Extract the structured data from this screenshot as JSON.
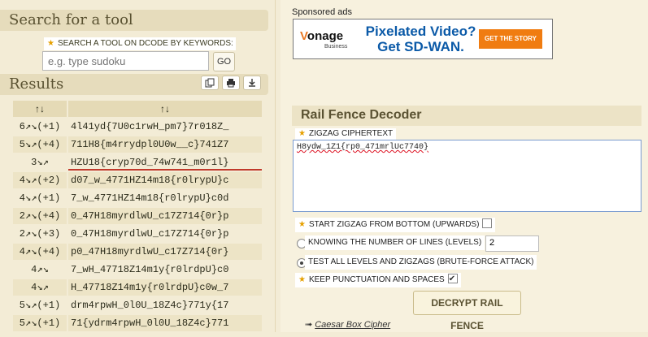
{
  "left": {
    "search_title": "Search for a tool",
    "search_label": "SEARCH A TOOL ON DCODE BY KEYWORDS:",
    "search_placeholder": "e.g. type sudoku",
    "go_label": "GO",
    "results_title": "Results",
    "table_header": [
      "↑↓",
      "↑↓"
    ],
    "rows": [
      {
        "param": "6↗↘(+1)",
        "text": "4l41yd{7U0c1rwH_pm7}7r018Z_"
      },
      {
        "param": "5↘↗(+4)",
        "text": "711H8{m4rrydpl0U0w__c}741Z7"
      },
      {
        "param": "3↘↗",
        "text": "HZU18{cryp70d_74w741_m0r1l}"
      },
      {
        "param": "4↘↗(+2)",
        "text": "d07_w_4771HZ14m18{r0lrypU}c"
      },
      {
        "param": "4↘↗(+1)",
        "text": "7_w_4771HZ14m18{r0lrypU}c0d"
      },
      {
        "param": "2↗↘(+4)",
        "text": "0_47H18myrdlwU_c17Z714{0r}p"
      },
      {
        "param": "2↗↘(+3)",
        "text": "0_47H18myrdlwU_c17Z714{0r}p"
      },
      {
        "param": "4↗↘(+4)",
        "text": "p0_47H18myrdlwU_c17Z714{0r}"
      },
      {
        "param": "4↗↘",
        "text": "7_wH_47718Z14m1y{r0lrdpU}c0"
      },
      {
        "param": "4↘↗",
        "text": "H_47718Z14m1y{r0lrdpU}c0w_7"
      },
      {
        "param": "5↘↗(+1)",
        "text": "drm4rpwH_0l0U_18Z4c}771y{17"
      },
      {
        "param": "5↗↘(+1)",
        "text": "71{ydrm4rpwH_0l0U_18Z4c}771"
      }
    ]
  },
  "ads": {
    "sponsored_label": "Sponsored ads",
    "brand": "onage",
    "brand_v": "V",
    "brand_sub": "Business",
    "headline_1": "Pixelated Video?",
    "headline_2": "Get SD-WAN.",
    "cta": "GET THE STORY"
  },
  "tool": {
    "title": "Rail Fence Decoder",
    "ciphertext_label": "ZIGZAG CIPHERTEXT",
    "ciphertext_value": "H8ydw_1Z1{rp0_471mrlUc7740}",
    "start_bottom_label": "START ZIGZAG FROM BOTTOM (UPWARDS)",
    "known_lines_label": "KNOWING THE NUMBER OF LINES (LEVELS)",
    "levels_value": "2",
    "bruteforce_label": "TEST ALL LEVELS AND ZIGZAGS (BRUTE-FORCE ATTACK)",
    "keep_punct_label": "KEEP PUNCTUATION AND SPACES",
    "decrypt_label": "DECRYPT RAIL FENCE",
    "related_link": "Caesar Box Cipher"
  },
  "colors": {
    "accent_star": "#e6a000",
    "ad_cta": "#f07c11",
    "ad_headline": "#0b5aa8",
    "highlight_underline": "#c0392b"
  }
}
